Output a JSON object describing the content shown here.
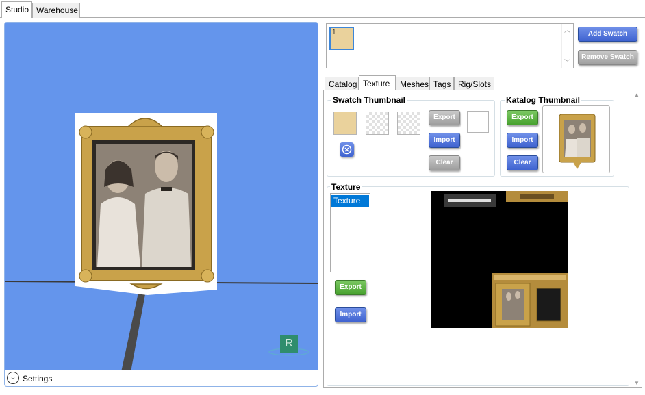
{
  "top_tabs": {
    "studio": "Studio",
    "warehouse": "Warehouse"
  },
  "viewport": {
    "settings_label": "Settings",
    "gizmo_letter": "R"
  },
  "swatch": {
    "item_number": "1",
    "item_color": "#ead29c",
    "add_label": "Add Swatch",
    "remove_label": "Remove Swatch"
  },
  "panel_tabs": [
    "Catalog",
    "Texture",
    "Meshes",
    "Tags",
    "Rig/Slots"
  ],
  "swatch_thumbnail": {
    "title": "Swatch Thumbnail",
    "export": "Export",
    "import": "Import",
    "clear": "Clear"
  },
  "katalog_thumbnail": {
    "title": "Katalog Thumbnail",
    "export": "Export",
    "import": "Import",
    "clear": "Clear"
  },
  "texture": {
    "title": "Texture",
    "items": [
      "Texture"
    ],
    "export": "Export",
    "import": "Import"
  },
  "colors": {
    "viewport_bg": "#6495ec",
    "accent_blue": "#3f63d0",
    "accent_green": "#47a12e",
    "selection": "#0078d7"
  }
}
